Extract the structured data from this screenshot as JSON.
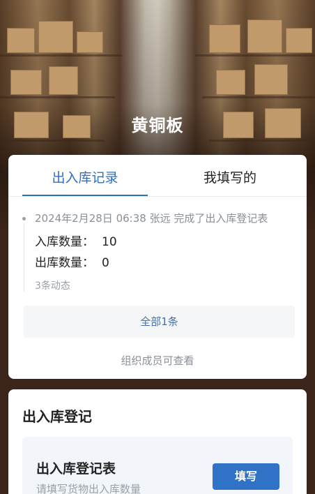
{
  "header": {
    "title": "黄铜板"
  },
  "tabs": [
    {
      "label": "出入库记录",
      "active": true
    },
    {
      "label": "我填写的",
      "active": false
    }
  ],
  "activity": {
    "headline": "2024年2月28日 06:38  张远  完成了出入库登记表",
    "fields": [
      {
        "label": "入库数量：",
        "value": "10"
      },
      {
        "label": "出库数量：",
        "value": "0"
      }
    ],
    "count_text": "3条动态"
  },
  "all_button_label": "全部1条",
  "visibility_note": "组织成员可查看",
  "register_section": {
    "title": "出入库登记",
    "form_name": "出入库登记表",
    "form_desc": "请填写货物出入库数量",
    "fill_label": "填写"
  },
  "colors": {
    "accent": "#2b6fc7",
    "button": "#2f72c6",
    "page_bg": "#3b2419"
  }
}
